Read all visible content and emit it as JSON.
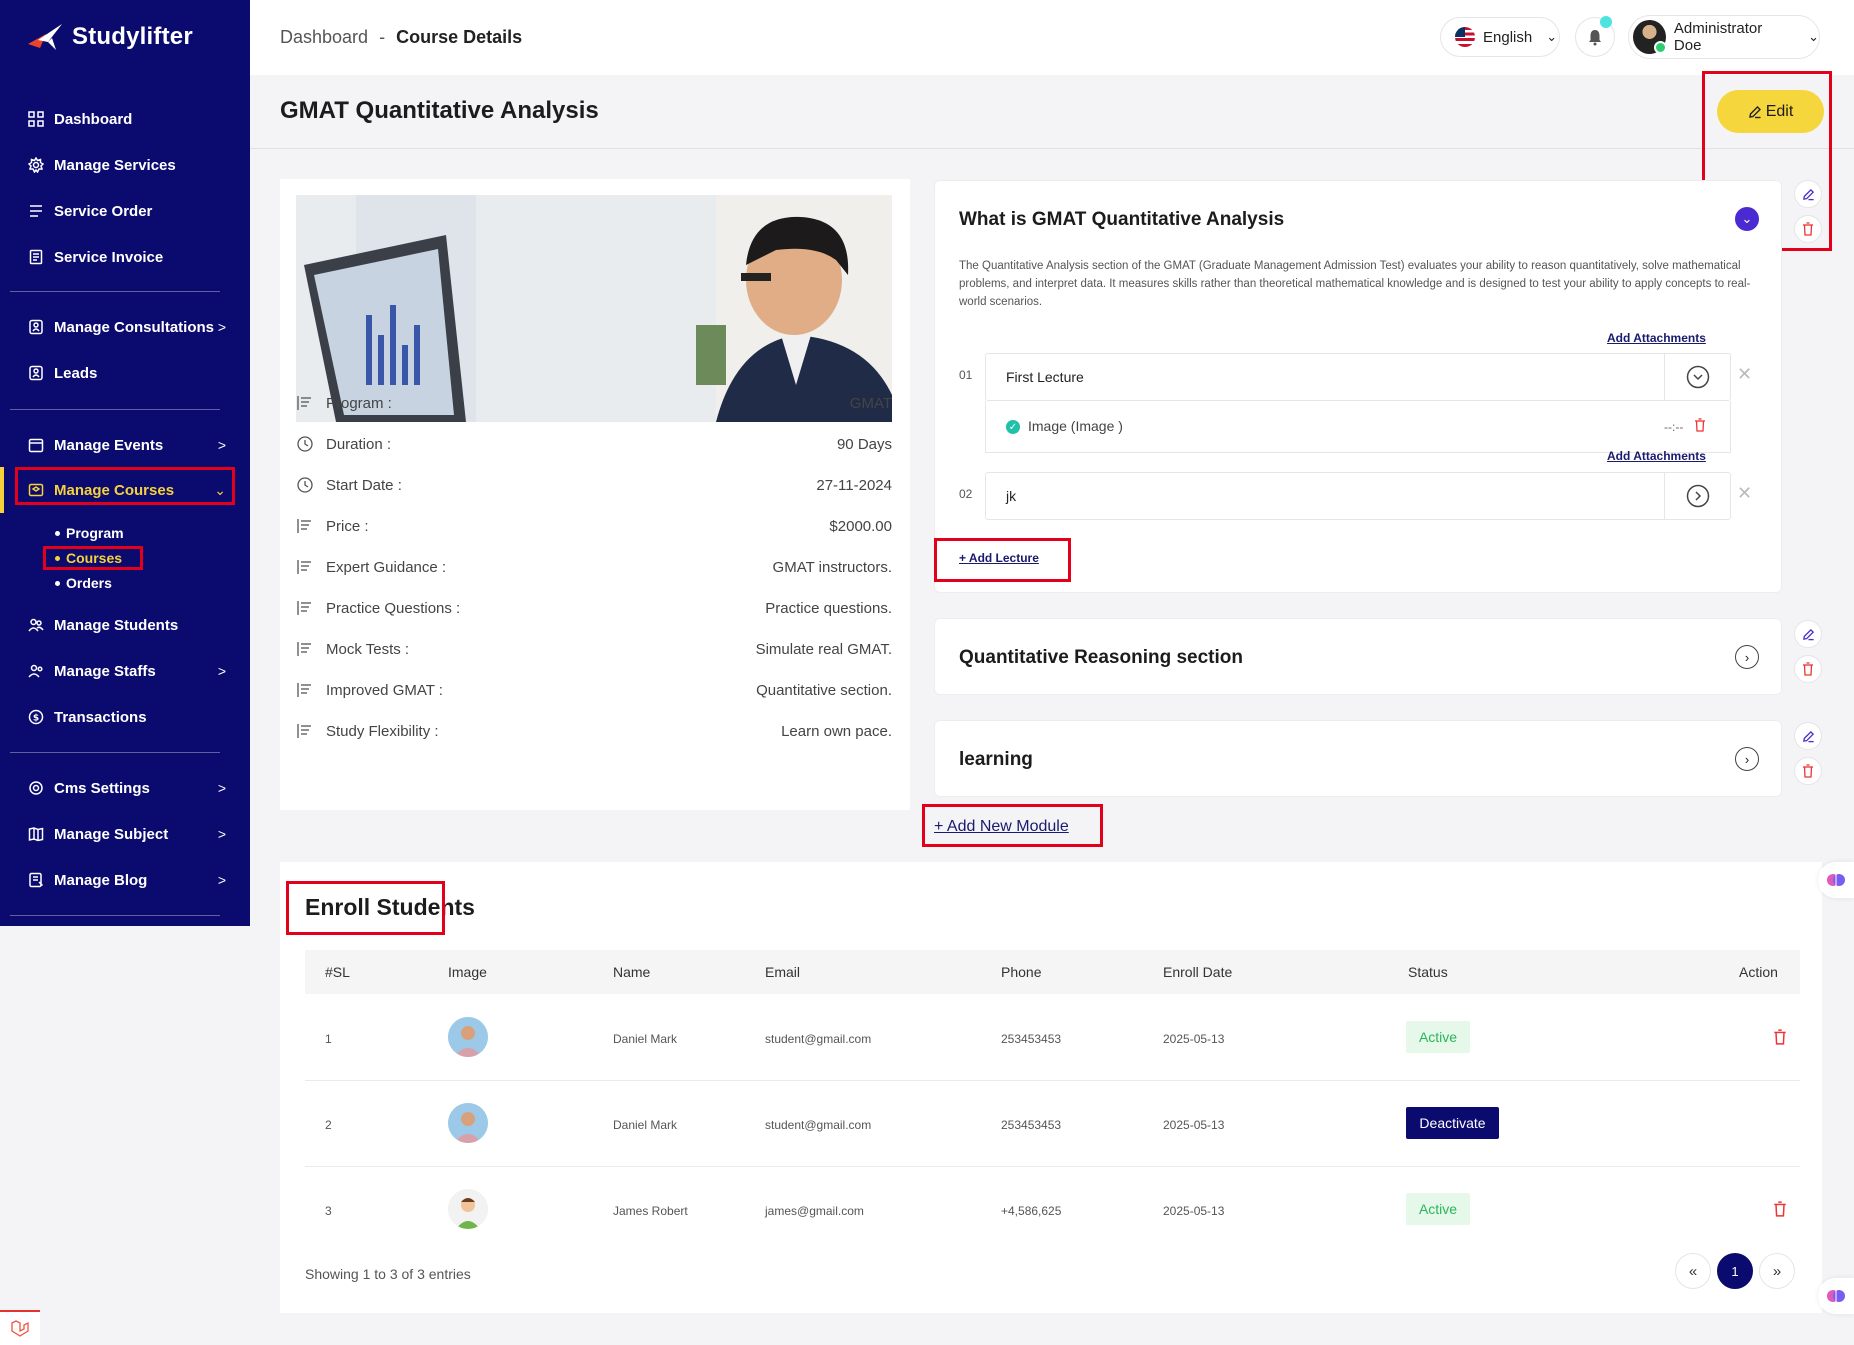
{
  "app": {
    "name": "Studylifter"
  },
  "sidebar": {
    "items": [
      {
        "label": "Dashboard",
        "icon": "grid-icon"
      },
      {
        "label": "Manage Services",
        "icon": "gear-icon"
      },
      {
        "label": "Service Order",
        "icon": "list-icon"
      },
      {
        "label": "Service Invoice",
        "icon": "invoice-icon"
      },
      {
        "label": "Manage Consultations",
        "icon": "chat-icon"
      },
      {
        "label": "Leads",
        "icon": "leads-icon"
      },
      {
        "label": "Manage Events",
        "icon": "calendar-icon"
      },
      {
        "label": "Manage Courses",
        "icon": "course-icon"
      },
      {
        "label": "Manage Students",
        "icon": "students-icon"
      },
      {
        "label": "Manage Staffs",
        "icon": "staff-icon"
      },
      {
        "label": "Transactions",
        "icon": "transactions-icon"
      },
      {
        "label": "Cms Settings",
        "icon": "settings-icon"
      },
      {
        "label": "Manage Subject",
        "icon": "book-icon"
      },
      {
        "label": "Manage Blog",
        "icon": "blog-icon"
      }
    ],
    "sub_items": [
      "Program",
      "Courses",
      "Orders"
    ]
  },
  "header": {
    "breadcrumb_root": "Dashboard",
    "breadcrumb_sep": "-",
    "breadcrumb_current": "Course Details",
    "language": "English",
    "user_name": "Administrator Doe"
  },
  "page": {
    "title": "GMAT Quantitative Analysis",
    "edit_label": "Edit"
  },
  "course_info": [
    {
      "label": "Program :",
      "value": "GMAT"
    },
    {
      "label": "Duration :",
      "value": "90 Days"
    },
    {
      "label": "Start Date :",
      "value": "27-11-2024"
    },
    {
      "label": "Price :",
      "value": "$2000.00"
    },
    {
      "label": "Expert Guidance :",
      "value": "GMAT instructors."
    },
    {
      "label": "Practice Questions :",
      "value": "Practice questions."
    },
    {
      "label": "Mock Tests :",
      "value": "Simulate real GMAT."
    },
    {
      "label": "Improved GMAT :",
      "value": "Quantitative section."
    },
    {
      "label": "Study Flexibility :",
      "value": "Learn own pace."
    }
  ],
  "modules": [
    {
      "title": "What is GMAT Quantitative Analysis",
      "description": "The Quantitative Analysis section of the GMAT (Graduate Management Admission Test) evaluates your ability to reason quantitatively, solve mathematical problems, and interpret data. It measures skills rather than theoretical mathematical knowledge and is designed to test your ability to apply concepts to real-world scenarios.",
      "lectures": [
        {
          "num": "01",
          "name": "First Lecture",
          "attachment": "Image (Image )",
          "duration": "--:--"
        },
        {
          "num": "02",
          "name": "jk"
        }
      ],
      "add_attachments": "Add Attachments",
      "add_lecture": "+ Add Lecture"
    },
    {
      "title": "Quantitative Reasoning section"
    },
    {
      "title": "learning"
    }
  ],
  "add_module_label": "+ Add New Module",
  "enroll": {
    "title": "Enroll Students",
    "columns": [
      "#SL",
      "Image",
      "Name",
      "Email",
      "Phone",
      "Enroll Date",
      "Status",
      "Action"
    ],
    "rows": [
      {
        "sl": "1",
        "name": "Daniel Mark",
        "email": "student@gmail.com",
        "phone": "253453453",
        "date": "2025-05-13",
        "status": "Active"
      },
      {
        "sl": "2",
        "name": "Daniel Mark",
        "email": "student@gmail.com",
        "phone": "253453453",
        "date": "2025-05-13",
        "status": "Deactivate"
      },
      {
        "sl": "3",
        "name": "James Robert",
        "email": "james@gmail.com",
        "phone": "+4,586,625",
        "date": "2025-05-13",
        "status": "Active"
      }
    ],
    "showing": "Showing 1 to 3 of 3 entries",
    "pagination": {
      "prev": "«",
      "current": "1",
      "next": "»"
    }
  },
  "colors": {
    "sidebar": "#0b0a6e",
    "accent": "#f6d23a",
    "highlight": "#e3001b",
    "purple": "#4b2bd1"
  }
}
